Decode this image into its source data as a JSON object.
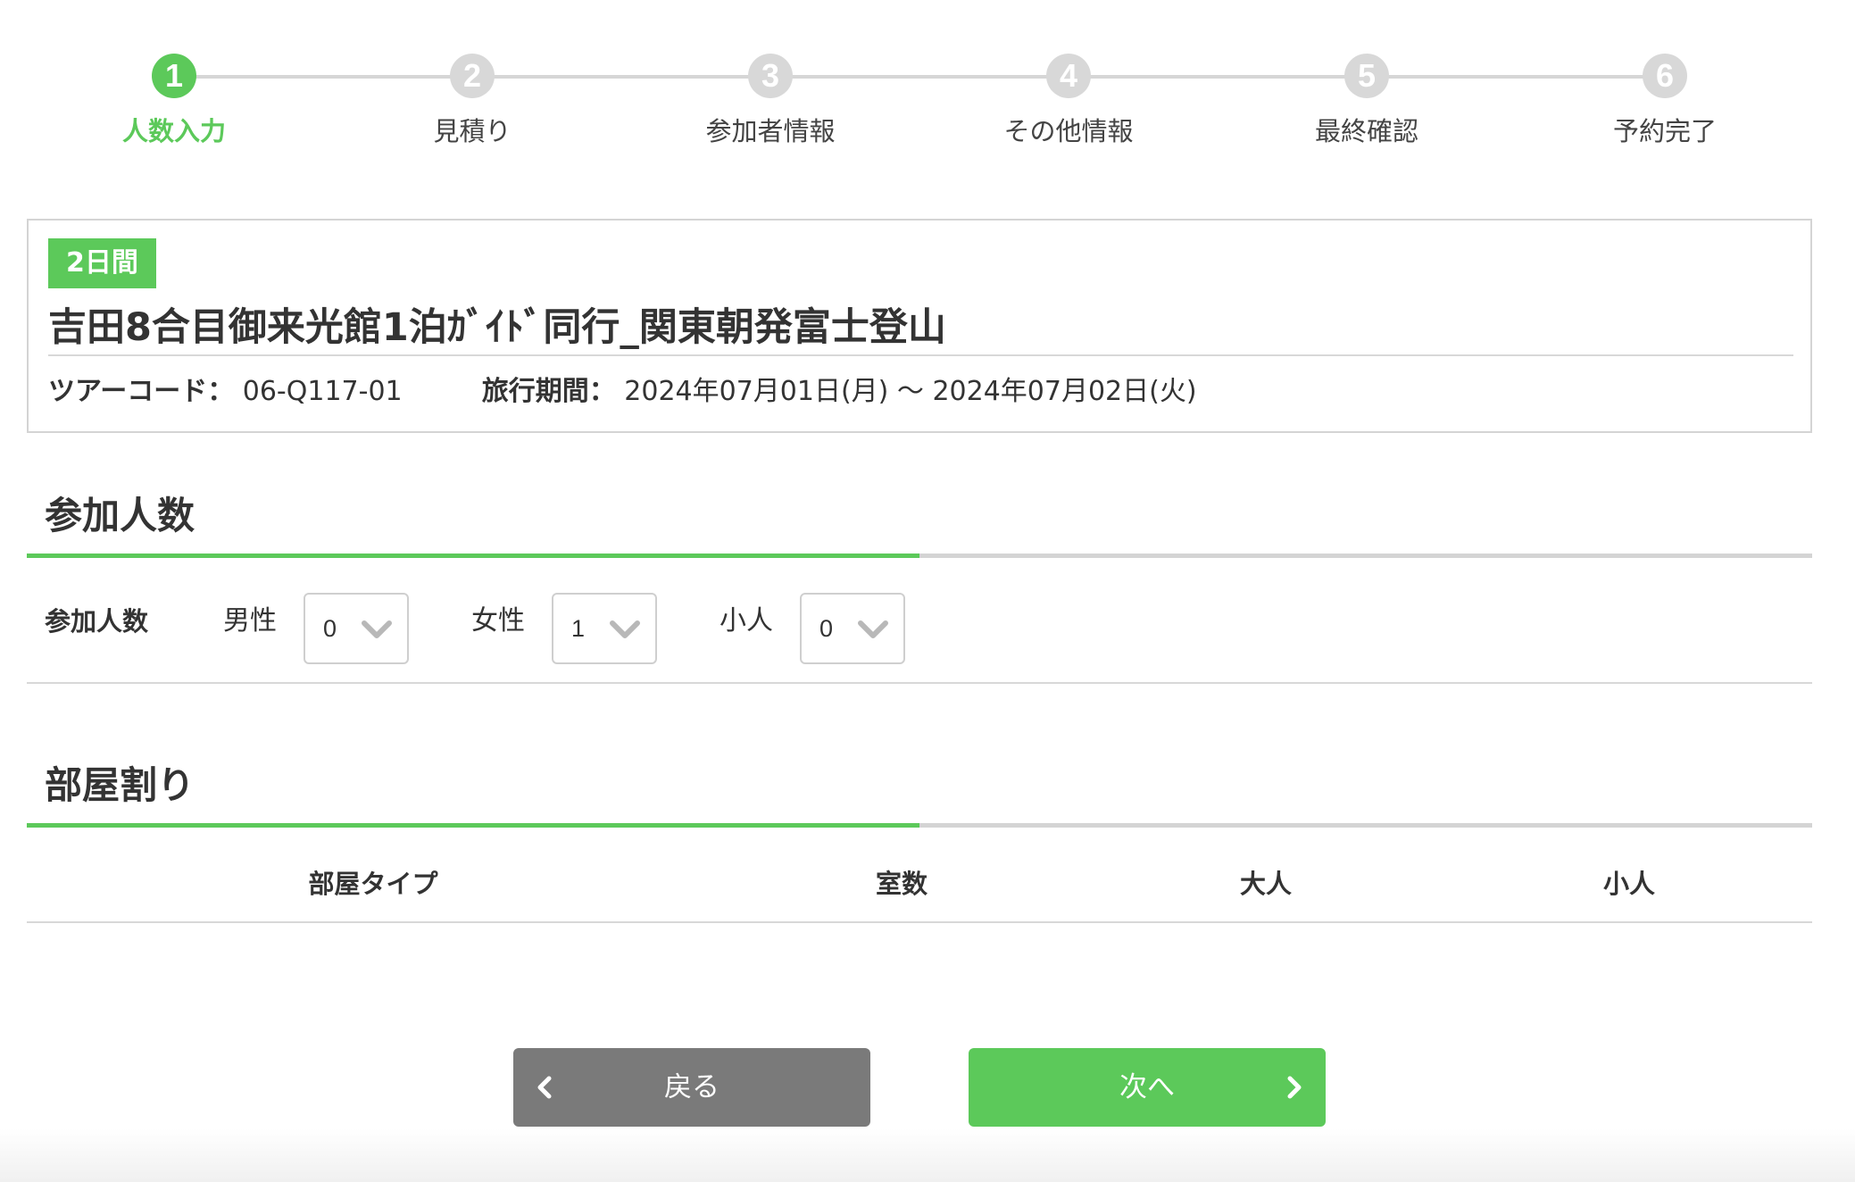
{
  "stepper": {
    "steps": [
      {
        "number": "1",
        "label": "人数入力"
      },
      {
        "number": "2",
        "label": "見積り"
      },
      {
        "number": "3",
        "label": "参加者情報"
      },
      {
        "number": "4",
        "label": "その他情報"
      },
      {
        "number": "5",
        "label": "最終確認"
      },
      {
        "number": "6",
        "label": "予約完了"
      }
    ],
    "current_step": 1,
    "active_color": "#5cc95a",
    "inactive_color": "#d8d8d8"
  },
  "tour": {
    "duration_badge": "2日間",
    "title": "吉田8合目御来光館1泊ｶﾞｲﾄﾞ同行_関東朝発富士登山",
    "code_label": "ツアーコード：",
    "code_value": "06-Q117-01",
    "period_label": "旅行期間：",
    "period_value": "2024年07月01日(月) 〜 2024年07月02日(火)"
  },
  "participants": {
    "section_title": "参加人数",
    "row_label": "参加人数",
    "male_label": "男性",
    "male_value": "0",
    "female_label": "女性",
    "female_value": "1",
    "child_label": "小人",
    "child_value": "0"
  },
  "rooms": {
    "section_title": "部屋割り",
    "columns": [
      "部屋タイプ",
      "室数",
      "大人",
      "小人"
    ]
  },
  "nav": {
    "back_label": "戻る",
    "next_label": "次へ",
    "back_icon": "chevron-left-icon",
    "next_icon": "chevron-right-icon",
    "back_color": "#7a7a7a",
    "next_color": "#5cc95a"
  }
}
